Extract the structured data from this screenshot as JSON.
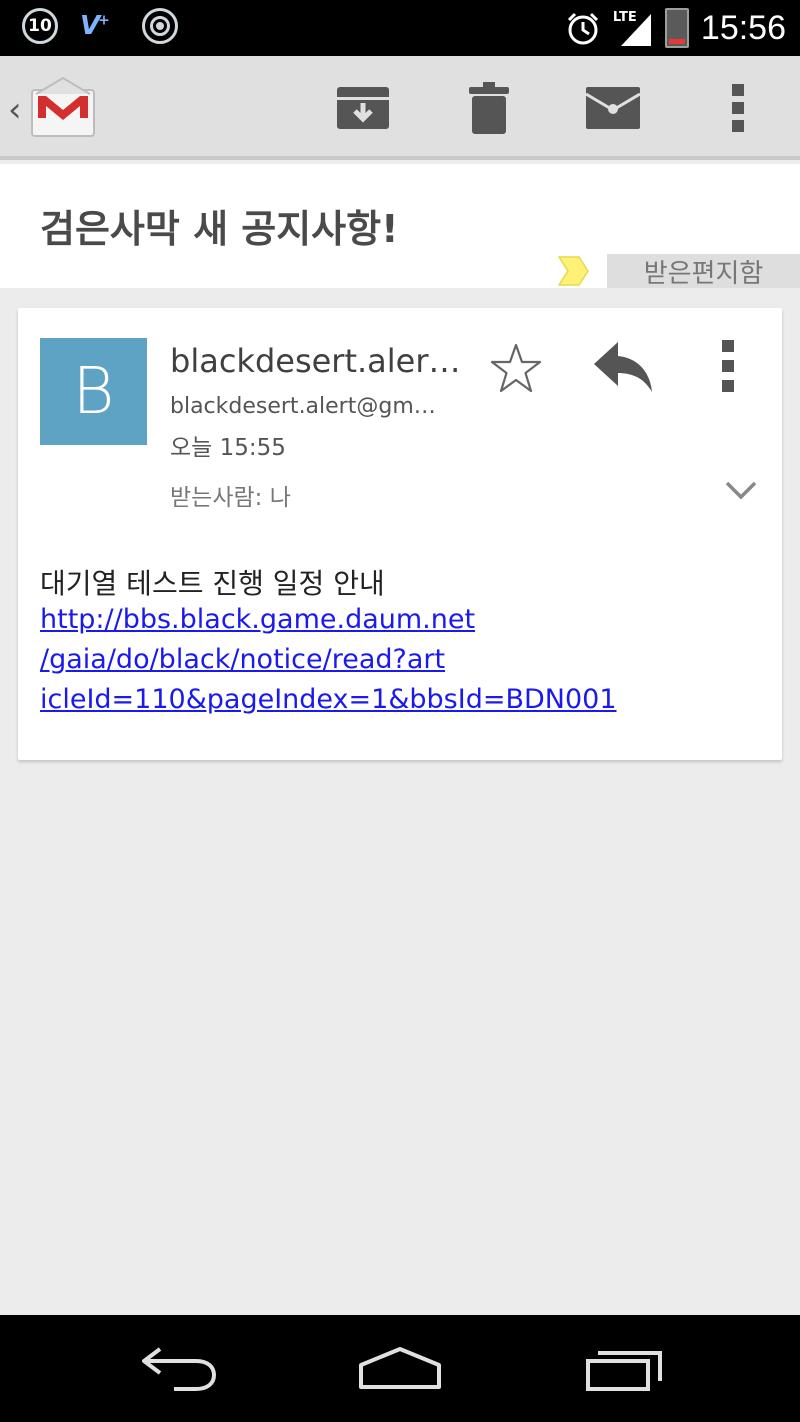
{
  "status_bar": {
    "notification_count": "10",
    "v_app_label": "V",
    "network_type": "LTE",
    "time": "15:56"
  },
  "action_bar": {
    "app": "Gmail",
    "actions": [
      "archive",
      "delete",
      "mark-unread",
      "more"
    ]
  },
  "conversation": {
    "subject": "검은사막 새 공지사항!",
    "label": "받은편지함"
  },
  "message": {
    "avatar_letter": "B",
    "avatar_color": "#5fa3c4",
    "sender_name": "blackdesert.alert…",
    "sender_email": "blackdesert.alert@gm…",
    "time": "오늘 15:55",
    "recipients": "받는사람: 나",
    "body_text": "대기열 테스트 진행 일정 안내",
    "body_link_lines": [
      "http://bbs.black.game.daum.net",
      "/gaia/do/black/notice/read?art",
      "icleId=110&pageIndex=1&bbsId=BDN001"
    ]
  },
  "colors": {
    "link": "#1a1aee",
    "label_chevron": "#fff176",
    "gmail_red": "#d32f2f"
  }
}
